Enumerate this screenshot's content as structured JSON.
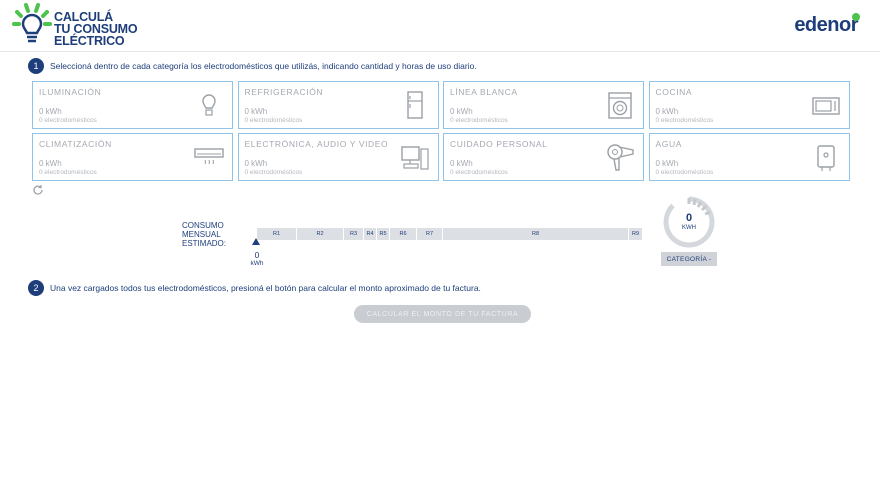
{
  "header": {
    "logo_lines": [
      "CALCULÁ",
      "TU CONSUMO",
      "ELÉCTRICO"
    ],
    "brand": "edenor"
  },
  "step1": {
    "number": "1",
    "text": "Seleccioná dentro de cada categoría los electrodomésticos que utilizás, indicando cantidad y horas de uso diario."
  },
  "categories": [
    {
      "title": "Iluminación",
      "kwh": "0 kWh",
      "count": "0 electrodomésticos",
      "icon": "bulb-icon"
    },
    {
      "title": "Refrigeración",
      "kwh": "0 kWh",
      "count": "0 electrodomésticos",
      "icon": "fridge-icon"
    },
    {
      "title": "Línea blanca",
      "kwh": "0 kWh",
      "count": "0 electrodomésticos",
      "icon": "washer-icon"
    },
    {
      "title": "Cocina",
      "kwh": "0 kWh",
      "count": "0 electrodomésticos",
      "icon": "microwave-icon"
    },
    {
      "title": "Climatización",
      "kwh": "0 kWh",
      "count": "0 electrodomésticos",
      "icon": "air-conditioner-icon"
    },
    {
      "title": "Electrónica, audio y video",
      "kwh": "0 kWh",
      "count": "0 electrodomésticos",
      "icon": "computer-icon"
    },
    {
      "title": "Cuidado personal",
      "kwh": "0 kWh",
      "count": "0 electrodomésticos",
      "icon": "hairdryer-icon"
    },
    {
      "title": "Agua",
      "kwh": "0 kWh",
      "count": "0 electrodomésticos",
      "icon": "water-heater-icon"
    }
  ],
  "consumo": {
    "label": "CONSUMO MENSUAL ESTIMADO:",
    "segments": [
      "R1",
      "R2",
      "R3",
      "R4",
      "R5",
      "R6",
      "R7",
      "R8",
      "R9"
    ],
    "marker_value": "0",
    "marker_unit": "kWh"
  },
  "gauge": {
    "value": "0",
    "unit": "KWH",
    "category_button": "CATEGORÍA -"
  },
  "step2": {
    "number": "2",
    "text": "Una vez cargados todos tus electrodomésticos, presioná el botón para calcular el monto aproximado de tu factura."
  },
  "calc_button": "Calcular el monto de tu factura",
  "colors": {
    "primary": "#1d3e7a",
    "accent": "#4cc34a",
    "border": "#8fc3e8"
  }
}
